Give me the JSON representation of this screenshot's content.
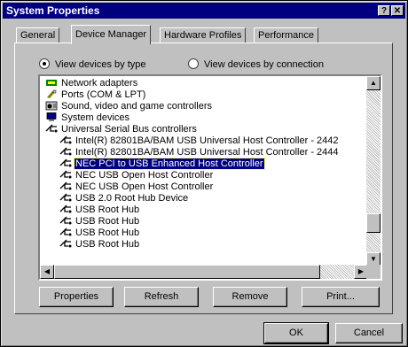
{
  "window": {
    "title": "System Properties",
    "help_glyph": "?",
    "close_glyph": "✕"
  },
  "tabs": [
    {
      "label": "General",
      "active": false
    },
    {
      "label": "Device Manager",
      "active": true
    },
    {
      "label": "Hardware Profiles",
      "active": false
    },
    {
      "label": "Performance",
      "active": false
    }
  ],
  "view_options": {
    "by_type": "View devices by type",
    "by_connection": "View devices by connection",
    "selected": "by_type"
  },
  "device_list": [
    {
      "label": "Network adapters",
      "icon": "network-icon",
      "indent": 0,
      "selected": false
    },
    {
      "label": "Ports (COM & LPT)",
      "icon": "port-icon",
      "indent": 0,
      "selected": false
    },
    {
      "label": "Sound, video and game controllers",
      "icon": "sound-icon",
      "indent": 0,
      "selected": false
    },
    {
      "label": "System devices",
      "icon": "computer-icon",
      "indent": 0,
      "selected": false
    },
    {
      "label": "Universal Serial Bus controllers",
      "icon": "usb-icon",
      "indent": 0,
      "selected": false
    },
    {
      "label": "Intel(R) 82801BA/BAM USB Universal Host Controller - 2442",
      "icon": "usb-icon",
      "indent": 1,
      "selected": false
    },
    {
      "label": "Intel(R) 82801BA/BAM USB Universal Host Controller - 2444",
      "icon": "usb-icon",
      "indent": 1,
      "selected": false
    },
    {
      "label": "NEC PCI to USB Enhanced Host Controller",
      "icon": "usb-icon",
      "indent": 1,
      "selected": true
    },
    {
      "label": "NEC USB Open Host Controller",
      "icon": "usb-icon",
      "indent": 1,
      "selected": false
    },
    {
      "label": "NEC USB Open Host Controller",
      "icon": "usb-icon",
      "indent": 1,
      "selected": false
    },
    {
      "label": "USB 2.0 Root Hub Device",
      "icon": "usb-icon",
      "indent": 1,
      "selected": false
    },
    {
      "label": "USB Root Hub",
      "icon": "usb-icon",
      "indent": 1,
      "selected": false
    },
    {
      "label": "USB Root Hub",
      "icon": "usb-icon",
      "indent": 1,
      "selected": false
    },
    {
      "label": "USB Root Hub",
      "icon": "usb-icon",
      "indent": 1,
      "selected": false
    },
    {
      "label": "USB Root Hub",
      "icon": "usb-icon",
      "indent": 1,
      "selected": false
    }
  ],
  "scroll": {
    "up": "▲",
    "down": "▼",
    "left": "◀",
    "right": "▶"
  },
  "buttons": {
    "properties": "Properties",
    "refresh": "Refresh",
    "remove": "Remove",
    "print": "Print...",
    "ok": "OK",
    "cancel": "Cancel"
  },
  "colors": {
    "title_bar": "#000080",
    "face": "#c0c0c0",
    "selection": "#000080"
  }
}
